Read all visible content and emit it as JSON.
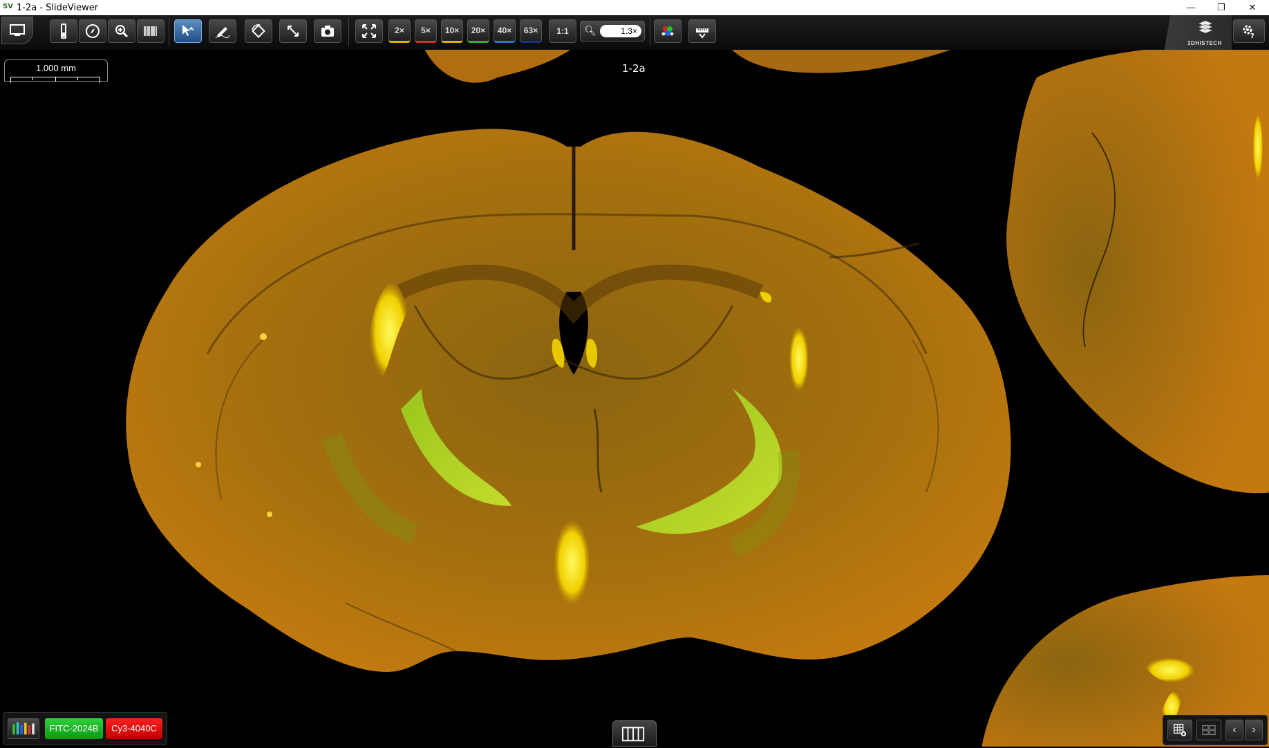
{
  "window": {
    "title": "1-2a - SlideViewer",
    "icon": "SV",
    "minimize_glyph": "—",
    "maximize_glyph": "❐",
    "close_glyph": "✕"
  },
  "toolbar": {
    "magnifications": [
      "2×",
      "5×",
      "10×",
      "20×",
      "40×",
      "63×"
    ],
    "one_to_one": "1:1",
    "zoom_value": "1.3×",
    "brand": "3DHISTECH",
    "colors": {
      "active_blue": "#3d75b5",
      "mag_2x": "#d4b400",
      "mag_5x": "#d03030",
      "mag_10x": "#d4b400",
      "mag_20x": "#2fb040",
      "mag_40x": "#3070d0",
      "mag_63x": "#203080"
    }
  },
  "viewer": {
    "slide_label": "1-2a",
    "scale_label": "1.000 mm"
  },
  "channels": [
    {
      "label": "FITC-2024B",
      "color": "#17b521"
    },
    {
      "label": "Cy3-4040C",
      "color": "#e00000"
    }
  ],
  "nav": {
    "prev": "‹",
    "next": "›"
  }
}
